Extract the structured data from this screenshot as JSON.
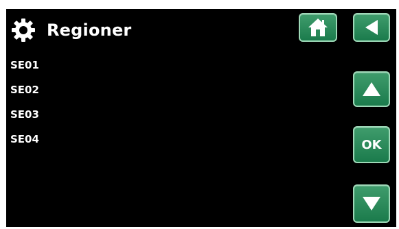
{
  "header": {
    "title": "Regioner",
    "settings_icon": "gear-icon"
  },
  "navigation": {
    "home_icon": "home-icon",
    "back_icon": "back-arrow-icon",
    "up_icon": "up-arrow-icon",
    "ok_label": "OK",
    "down_icon": "down-arrow-icon"
  },
  "regions": [
    "SE01",
    "SE02",
    "SE03",
    "SE04"
  ],
  "colors": {
    "background": "#000000",
    "button_green": "#2a8a5a",
    "button_border": "#9fd9b8",
    "text": "#ffffff"
  }
}
